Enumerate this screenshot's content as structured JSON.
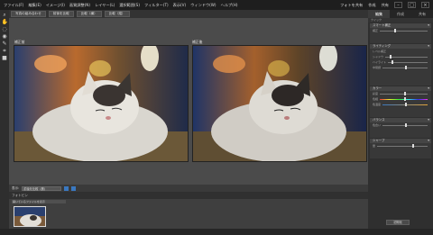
{
  "menubar": {
    "items": [
      "ファイル(F)",
      "編集(E)",
      "イメージ(I)",
      "画質調整(N)",
      "レイヤー(L)",
      "選択範囲(S)",
      "フィルター(T)",
      "表示(V)",
      "ウィンドウ(W)",
      "ヘルプ(H)"
    ],
    "right_items": [
      "フォトを共有",
      "作成",
      "共有"
    ]
  },
  "modebar": {
    "buttons": [
      "写真の組み合わせ",
      "前後を比較",
      "比較（横）",
      "比較（縦）"
    ]
  },
  "workspace": {
    "before_label": "補正前",
    "after_label": "補正後"
  },
  "optbar": {
    "zoom_label": "表示:",
    "zoom_value": "前後を比較（横）",
    "icons": [
      "rotate-left-icon",
      "rotate-right-icon"
    ]
  },
  "bin": {
    "header": "フォトビン",
    "select_value": "開いているファイルを表示"
  },
  "panel": {
    "tabs": [
      "編集",
      "作成",
      "共有"
    ],
    "sub_label": "クイック",
    "sections": [
      {
        "title": "スマート補正",
        "rows": [
          "補正"
        ]
      },
      {
        "title": "ライティング",
        "rows": [
          "レベル補正",
          "シャドウ",
          "ハイライト",
          "中間調"
        ]
      },
      {
        "title": "カラー",
        "rows": [
          "彩度",
          "色相",
          "色温度"
        ]
      },
      {
        "title": "バランス",
        "rows": [
          "色合い"
        ]
      },
      {
        "title": "シャープ",
        "rows": [
          "量"
        ]
      }
    ],
    "reset_label": "初期化"
  },
  "colors": {
    "accent": "#3a78c0",
    "panel_bg": "#2f2f2f",
    "workspace_bg": "#4b4b4b"
  }
}
